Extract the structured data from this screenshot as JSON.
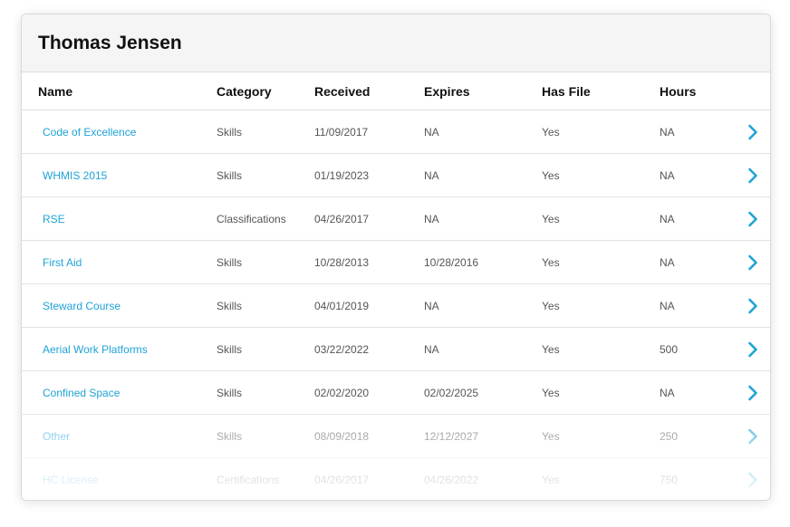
{
  "header": {
    "title": "Thomas Jensen"
  },
  "columns": {
    "name": "Name",
    "category": "Category",
    "received": "Received",
    "expires": "Expires",
    "has_file": "Has File",
    "hours": "Hours"
  },
  "rows": [
    {
      "name": "Code of Excellence",
      "category": "Skills",
      "received": "11/09/2017",
      "expires": "NA",
      "has_file": "Yes",
      "hours": "NA"
    },
    {
      "name": "WHMIS 2015",
      "category": "Skills",
      "received": "01/19/2023",
      "expires": "NA",
      "has_file": "Yes",
      "hours": "NA"
    },
    {
      "name": "RSE",
      "category": "Classifications",
      "received": "04/26/2017",
      "expires": "NA",
      "has_file": "Yes",
      "hours": "NA"
    },
    {
      "name": "First Aid",
      "category": "Skills",
      "received": "10/28/2013",
      "expires": "10/28/2016",
      "has_file": "Yes",
      "hours": "NA"
    },
    {
      "name": "Steward Course",
      "category": "Skills",
      "received": "04/01/2019",
      "expires": "NA",
      "has_file": "Yes",
      "hours": "NA"
    },
    {
      "name": "Aerial Work Platforms",
      "category": "Skills",
      "received": "03/22/2022",
      "expires": "NA",
      "has_file": "Yes",
      "hours": "500"
    },
    {
      "name": "Confined Space",
      "category": "Skills",
      "received": "02/02/2020",
      "expires": "02/02/2025",
      "has_file": "Yes",
      "hours": "NA"
    },
    {
      "name": "Other",
      "category": "Skills",
      "received": "08/09/2018",
      "expires": "12/12/2027",
      "has_file": "Yes",
      "hours": "250"
    },
    {
      "name": "HC License",
      "category": "Certifications",
      "received": "04/26/2017",
      "expires": "04/26/2022",
      "has_file": "Yes",
      "hours": "750"
    }
  ],
  "colors": {
    "accent": "#1ea3d6",
    "text": "#555555",
    "header_bg": "#f5f5f5"
  },
  "icons": {
    "row_action": "chevron-right-icon"
  }
}
